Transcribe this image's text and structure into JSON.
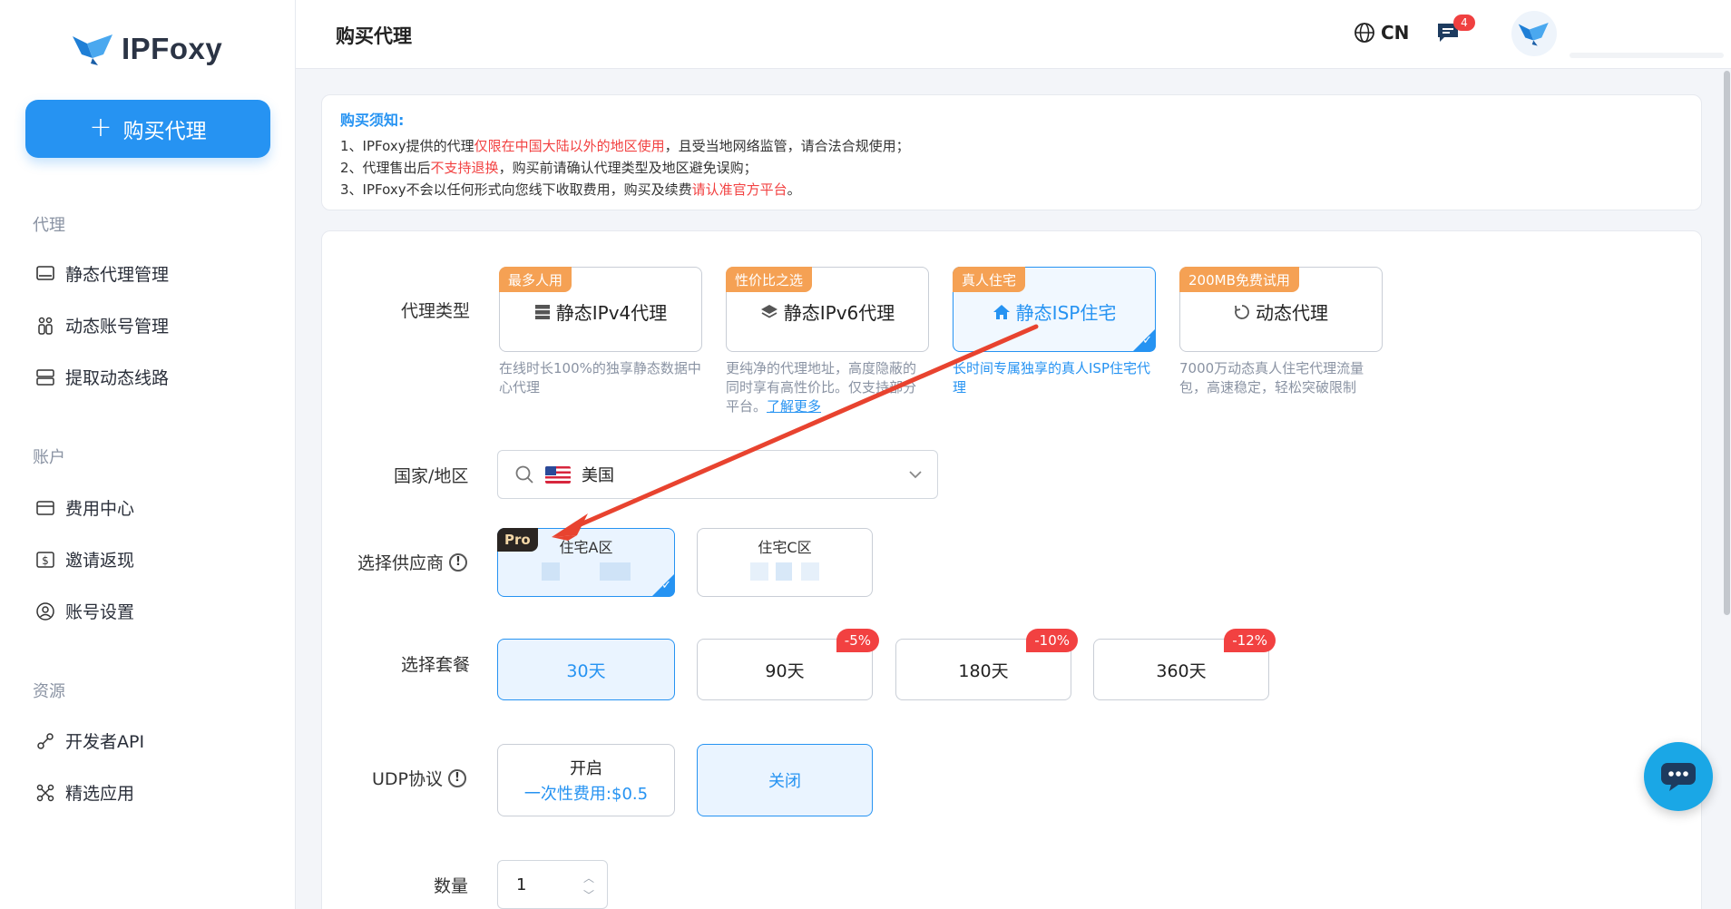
{
  "brand": {
    "name": "IPFoxy"
  },
  "sidebar": {
    "buy_button": "购买代理",
    "sections": [
      {
        "title": "代理",
        "items": [
          {
            "label": "静态代理管理",
            "icon": "monitor-icon"
          },
          {
            "label": "动态账号管理",
            "icon": "account-icon"
          },
          {
            "label": "提取动态线路",
            "icon": "server-icon"
          }
        ]
      },
      {
        "title": "账户",
        "items": [
          {
            "label": "费用中心",
            "icon": "wallet-icon"
          },
          {
            "label": "邀请返现",
            "icon": "dollar-icon"
          },
          {
            "label": "账号设置",
            "icon": "user-icon"
          }
        ]
      },
      {
        "title": "资源",
        "items": [
          {
            "label": "开发者API",
            "icon": "link-icon"
          },
          {
            "label": "精选应用",
            "icon": "apps-icon"
          }
        ]
      }
    ]
  },
  "header": {
    "title": "购买代理",
    "lang": "CN",
    "msg_count": "4"
  },
  "notice": {
    "title": "购买须知:",
    "line1": {
      "a": "1、IPFoxy提供的代理",
      "red": "仅限在中国大陆以外的地区使用",
      "b": "，且受当地网络监管，请合法合规使用；"
    },
    "line2": {
      "a": "2、代理售出后",
      "red": "不支持退换",
      "b": "，购买前请确认代理类型及地区避免误购；"
    },
    "line3": {
      "a": "3、IPFoxy不会以任何形式向您线下收取费用，购买及续费",
      "red": "请认准官方平台",
      "b": "。"
    }
  },
  "form": {
    "proxy_type_label": "代理类型",
    "types": [
      {
        "tag": "最多人用",
        "label": "静态IPv4代理",
        "desc": "在线时长100%的独享静态数据中心代理"
      },
      {
        "tag": "性价比之选",
        "label": "静态IPv6代理",
        "desc": "更纯净的代理地址，高度隐蔽的同时享有高性价比。仅支持部分平台。",
        "link": "了解更多"
      },
      {
        "tag": "真人住宅",
        "label": "静态ISP住宅",
        "desc": "长时间专属独享的真人ISP住宅代理"
      },
      {
        "tag": "200MB免费试用",
        "label": "动态代理",
        "desc": "7000万动态真人住宅代理流量包，高速稳定，轻松突破限制"
      }
    ],
    "country_label": "国家/地区",
    "country_value": "美国",
    "supplier_label": "选择供应商",
    "suppliers": [
      {
        "tag": "Pro",
        "name": "住宅A区"
      },
      {
        "name": "住宅C区"
      }
    ],
    "plan_label": "选择套餐",
    "plans": [
      {
        "label": "30天"
      },
      {
        "label": "90天",
        "discount": "-5%"
      },
      {
        "label": "180天",
        "discount": "-10%"
      },
      {
        "label": "360天",
        "discount": "-12%"
      }
    ],
    "udp_label": "UDP协议",
    "udp_on": {
      "title": "开启",
      "fee": "一次性费用:$0.5"
    },
    "udp_off": "关闭",
    "qty_label": "数量",
    "qty_value": "1",
    "help_mark": "!"
  },
  "colors": {
    "accent": "#2693f2",
    "tag_orange": "#f5a154",
    "discount_red": "#f24141",
    "annotation_arrow": "#e8432f"
  }
}
